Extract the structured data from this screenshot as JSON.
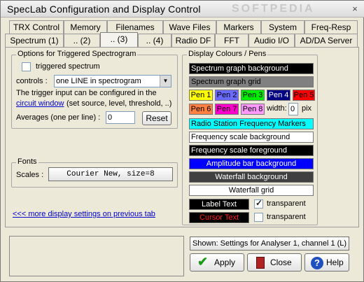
{
  "window": {
    "title": "SpecLab   Configuration and Display Control",
    "watermark": "SOFTPEDIA",
    "close": "×"
  },
  "tabs_row1": [
    "TRX Control",
    "Memory",
    "Filenames",
    "Wave Files",
    "Markers",
    "System",
    "Freq-Resp"
  ],
  "tabs_row2": [
    "Spectrum (1)",
    ".. (2)",
    ".. (3)",
    ".. (4)",
    "Radio DF",
    "FFT",
    "Audio I/O",
    "AD/DA Server"
  ],
  "triggered": {
    "group_title": "Options for Triggered Spectrogram",
    "checkbox_label": "triggered spectrum",
    "controls_label": "controls :",
    "controls_value": "one LINE in spectrogram",
    "hint_line1": "The trigger input can be configured in the",
    "circuit_link": "circuit window",
    "hint_line2_rest": "(set source, level, threshold, ..)",
    "averages_label": "Averages (one per line) :",
    "averages_value": "0",
    "reset": "Reset"
  },
  "fonts": {
    "group_title": "Fonts",
    "scales_label": "Scales :",
    "scales_value": "Courier New, size=8"
  },
  "more_link": "<<< more display settings on previous tab",
  "colours": {
    "group_title": "Display Colours / Pens",
    "spectrum_bg": "Spectrum graph background",
    "spectrum_grid": "Spectrum graph grid",
    "pens_row1": [
      {
        "label": "Pen 1",
        "bg": "#ffff00",
        "fg": "#000000"
      },
      {
        "label": "Pen 2",
        "bg": "#6a6aff",
        "fg": "#000000"
      },
      {
        "label": "Pen 3",
        "bg": "#00ee00",
        "fg": "#000000"
      },
      {
        "label": "Pen 4",
        "bg": "#000080",
        "fg": "#ffffff"
      },
      {
        "label": "Pen 5",
        "bg": "#ff0000",
        "fg": "#000000"
      }
    ],
    "pens_row2": [
      {
        "label": "Pen 6",
        "bg": "#ff8040",
        "fg": "#000000"
      },
      {
        "label": "Pen 7",
        "bg": "#ff00cc",
        "fg": "#000000"
      },
      {
        "label": "Pen 8",
        "bg": "#ff99ff",
        "fg": "#000000"
      }
    ],
    "width_label": "width:",
    "width_value": "0",
    "width_unit": "pix",
    "radio_markers": "Radio Station Frequency Markers",
    "freq_scale_bg": "Frequency scale background",
    "freq_scale_fg": "Frequency scale foreground",
    "amp_bar_bg": "Amplitude bar background",
    "waterfall_bg": "Waterfall background",
    "waterfall_grid": "Waterfall grid",
    "label_text": "Label Text",
    "cursor_text": "Cursor Text",
    "transparent1": "transparent",
    "transparent2": "transparent"
  },
  "footer": {
    "shown_info": "Shown: Settings for Analyser 1, channel 1 (L)",
    "apply": "Apply",
    "close": "Close",
    "help": "Help"
  }
}
